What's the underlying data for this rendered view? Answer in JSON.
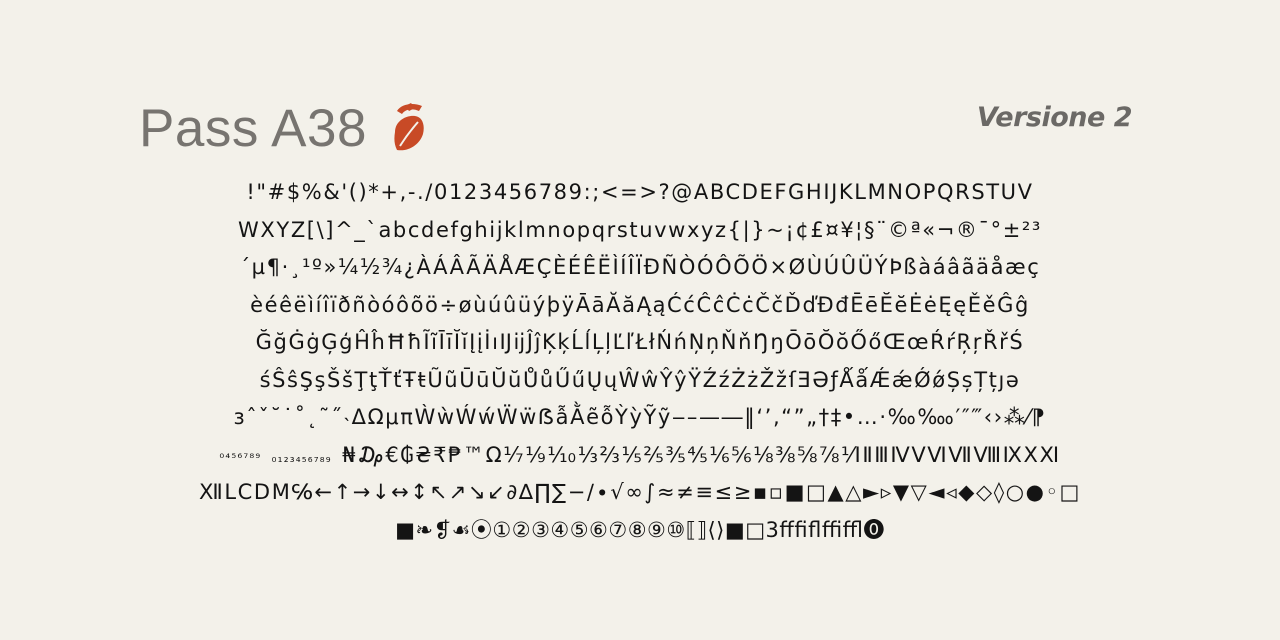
{
  "header": {
    "title": "Pass A38",
    "version": "Versione 2",
    "accent_color": "#c84a26",
    "logo_icon": "leaf-hat-logo-icon"
  },
  "glyph_rows": [
    "!\"#$%&'()*+,-./0123456789:;<=>?@ABCDEFGHIJKLMNOPQRSTUV",
    "WXYZ[\\]^_`abcdefghijklmnopqrstuvwxyz{|}~¡¢£¤¥¦§¨©ª«¬®¯°±²³",
    "´µ¶·¸¹º»¼½¾¿ÀÁÂÃÄÅÆÇÈÉÊËÌÍÎÏÐÑÒÓÔÕÖ×ØÙÚÛÜÝÞßàáâãäåæç",
    "èéêëìíîïðñòóôõö÷øùúûüýþÿĀāĂăĄąĆćĈĉĊċČčĎďĐđĒēĔĕĖėĘęĚěĜĝ",
    "ĞğĠġĢģĤĥĦħĨĩĪīĬĭĮįİıĲĳĴĵĶķĹĺĻļĽľŁłŃńŅņŇňŊŋŌōŎŏŐőŒœŔŕŖŗŘřŚ",
    "śŜŝŞşŠšŢţŤťŦŧŨũŪūŬŭŮůŰűŲųŴŵŶŷŸŹźŻżŽžſƎƏƒǺǻǼǽǾǿȘșȚțȷə",
    "ɜˆˇ˘˙˚˛˜˝˴ΔΩμπẀẁẂẃẄẅẞẫẰẽỗỲỳỸỹ‒–—―‖‘’‚“”„†‡•…·‰‱′″‴‹›⁂⁄⁋"
  ],
  "small_row": {
    "superiors": "⁰⁴⁵⁶⁷⁸⁹",
    "inferiors": "₀₁₂₃₄₅₆₇₈₉",
    "rest": "₦₯€₲₴₹₱™Ω⅐⅑⅒⅓⅔⅕⅖⅗⅘⅙⅚⅛⅜⅝⅞⅟ⅠⅡⅢⅣⅤⅥⅦⅧⅨⅩⅪ"
  },
  "glyph_rows_2": [
    "ⅫⅬⅭⅮⅯ℅←↑→↓↔↕↖↗↘↙∂∆∏∑−∕∙√∞∫≈≠≡≤≥▪▫■□▲△►▹▼▽◄◃◆◇◊○●◦□",
    "■❧❡☙⦿①②③④⑤⑥⑦⑧⑨⑩⟦⟧⟨⟩■□3ﬀﬁﬂﬃﬄ⓿"
  ]
}
